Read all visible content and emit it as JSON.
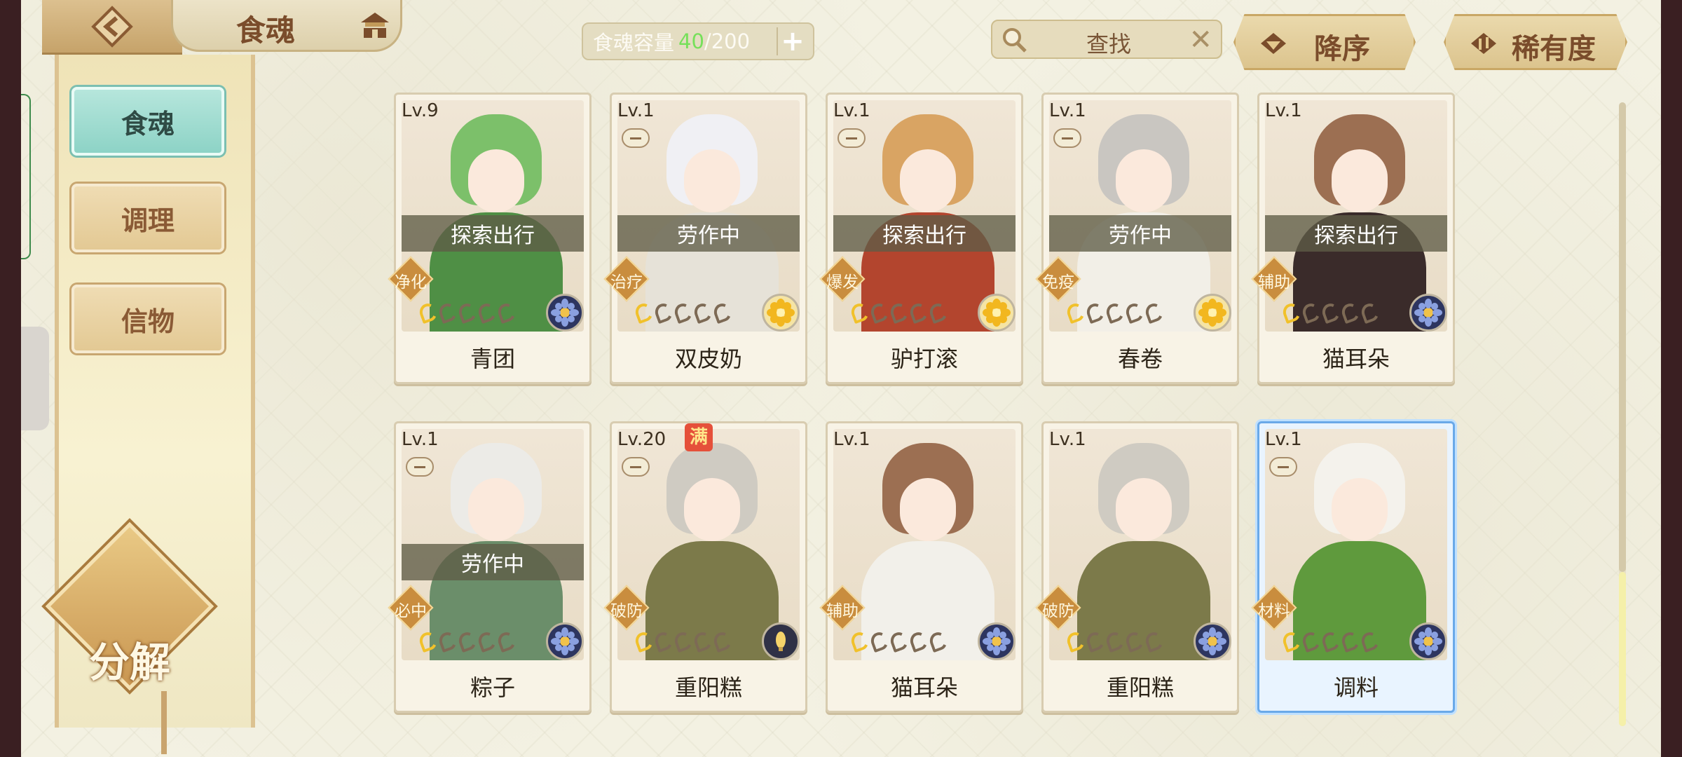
{
  "header": {
    "title": "食魂",
    "capacity_label": "食魂容量",
    "capacity_current": "40",
    "capacity_max": "/200",
    "capacity_add": "+",
    "search_placeholder": "查找",
    "search_clear": "✕",
    "sort_order_label": "降序",
    "sort_key_label": "稀有度"
  },
  "sidebar": {
    "tabs": [
      {
        "label": "食魂",
        "active": true
      },
      {
        "label": "调理",
        "active": false
      },
      {
        "label": "信物",
        "active": false
      }
    ],
    "decompose_label": "分解"
  },
  "cards": [
    {
      "level": "Lv.9",
      "status": "探索出行",
      "role": "净化",
      "name": "青团",
      "stars_lit": 1,
      "element": "blue",
      "palette": [
        "#7cc06a",
        "#4f8f45"
      ],
      "badge": false,
      "special": false,
      "mini_icon": false
    },
    {
      "level": "Lv.1",
      "status": "劳作中",
      "role": "治疗",
      "name": "双皮奶",
      "stars_lit": 1,
      "element": "gold",
      "palette": [
        "#f0f0f4",
        "#e6e2d8"
      ],
      "badge": false,
      "special": false,
      "mini_icon": true
    },
    {
      "level": "Lv.1",
      "status": "探索出行",
      "role": "爆发",
      "name": "驴打滚",
      "stars_lit": 1,
      "element": "gold",
      "palette": [
        "#d9a463",
        "#b3452e"
      ],
      "badge": false,
      "special": false,
      "mini_icon": true
    },
    {
      "level": "Lv.1",
      "status": "劳作中",
      "role": "免疫",
      "name": "春卷",
      "stars_lit": 1,
      "element": "gold",
      "palette": [
        "#c9c6c1",
        "#f2efe7"
      ],
      "badge": false,
      "special": false,
      "mini_icon": true
    },
    {
      "level": "Lv.1",
      "status": "探索出行",
      "role": "辅助",
      "name": "猫耳朵",
      "stars_lit": 1,
      "element": "blue",
      "palette": [
        "#9c6f52",
        "#3a2b2a"
      ],
      "badge": false,
      "special": false,
      "mini_icon": false
    },
    {
      "level": "Lv.1",
      "status": "劳作中",
      "role": "必中",
      "name": "粽子",
      "stars_lit": 1,
      "element": "blue",
      "palette": [
        "#ecebe7",
        "#6b8e6a"
      ],
      "badge": false,
      "special": false,
      "mini_icon": true
    },
    {
      "level": "Lv.20",
      "status": "",
      "role": "破防",
      "name": "重阳糕",
      "stars_lit": 1,
      "element": "dark",
      "palette": [
        "#cfcbc2",
        "#7c7a4a"
      ],
      "badge": true,
      "badge_text": "满",
      "special": false,
      "mini_icon": true
    },
    {
      "level": "Lv.1",
      "status": "",
      "role": "辅助",
      "name": "猫耳朵",
      "stars_lit": 1,
      "element": "blue",
      "palette": [
        "#9c6f52",
        "#f2f0ea"
      ],
      "badge": false,
      "special": false,
      "mini_icon": false
    },
    {
      "level": "Lv.1",
      "status": "",
      "role": "破防",
      "name": "重阳糕",
      "stars_lit": 1,
      "element": "blue",
      "palette": [
        "#cfcbc2",
        "#7c7a4a"
      ],
      "badge": false,
      "special": false,
      "mini_icon": false
    },
    {
      "level": "Lv.1",
      "status": "",
      "role": "材料",
      "name": "调料",
      "stars_lit": 1,
      "element": "blue",
      "palette": [
        "#f4f2ec",
        "#5f9a3d"
      ],
      "badge": false,
      "special": true,
      "mini_icon": true
    }
  ],
  "colors": {
    "accent_gold": "#c98d3e",
    "active_tab": "#8dd3c6",
    "capacity_current": "#76e05a"
  },
  "icons": [
    "back-arrow-icon",
    "home-pavilion-icon",
    "search-icon",
    "close-icon",
    "sort-down-icon",
    "sort-swap-icon",
    "element-icon"
  ]
}
